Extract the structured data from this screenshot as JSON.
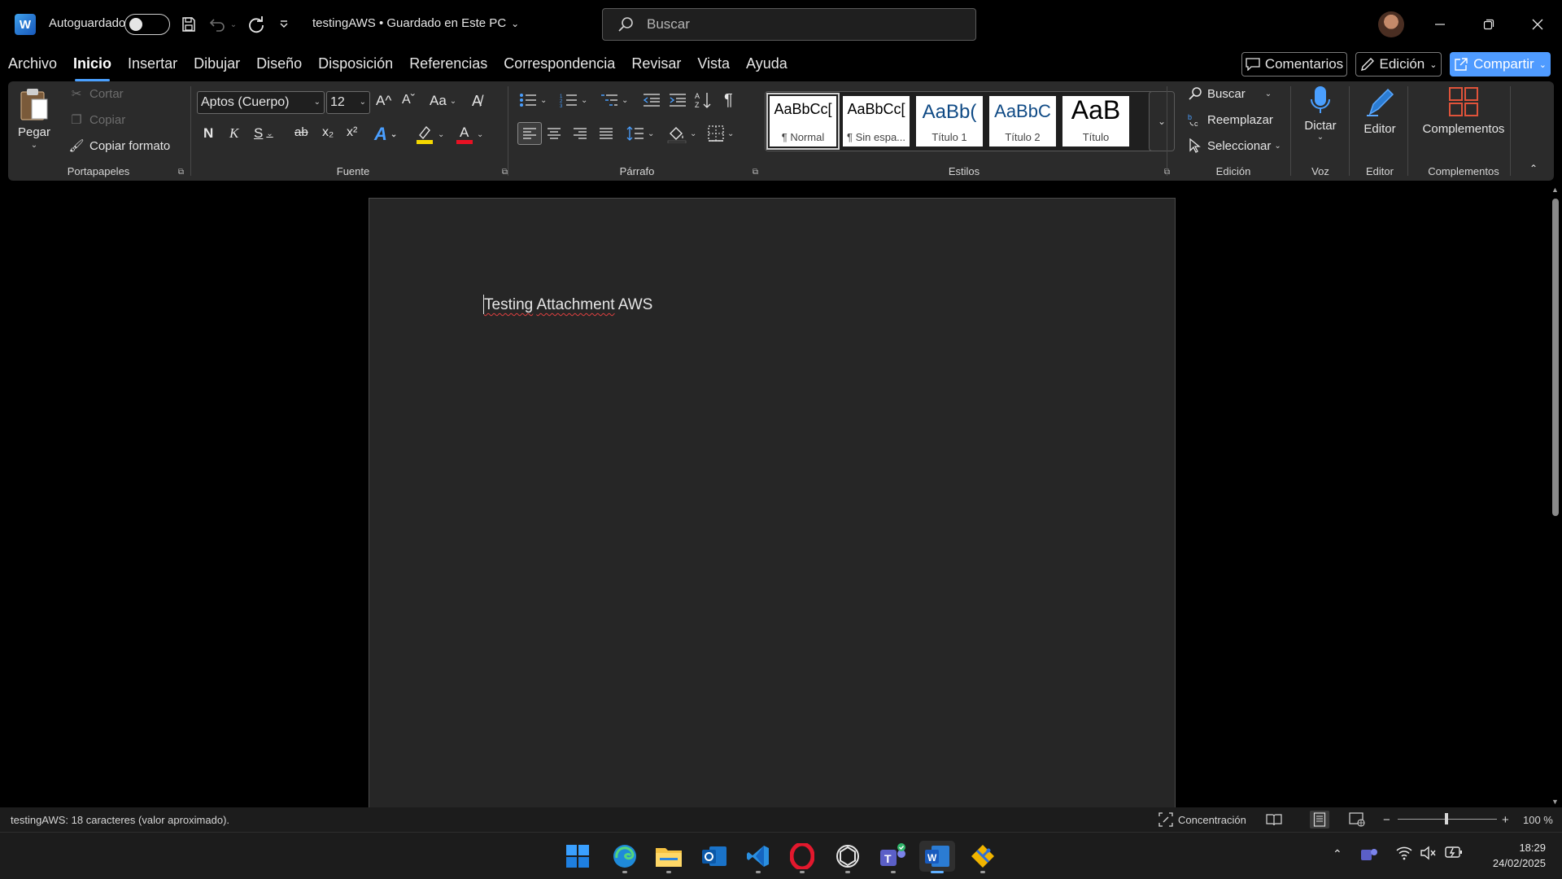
{
  "titlebar": {
    "autosave_label": "Autoguardado",
    "doc_title": "testingAWS • Guardado en Este PC",
    "search_placeholder": "Buscar"
  },
  "tabs": [
    "Archivo",
    "Inicio",
    "Insertar",
    "Dibujar",
    "Diseño",
    "Disposición",
    "Referencias",
    "Correspondencia",
    "Revisar",
    "Vista",
    "Ayuda"
  ],
  "active_tab": "Inicio",
  "right_buttons": {
    "comments": "Comentarios",
    "editing": "Edición",
    "share": "Compartir"
  },
  "ribbon": {
    "clipboard": {
      "paste": "Pegar",
      "cut": "Cortar",
      "copy": "Copiar",
      "format_painter": "Copiar formato",
      "label": "Portapapeles"
    },
    "font": {
      "name": "Aptos (Cuerpo)",
      "size": "12",
      "grow_glyph": "A^",
      "shrink_glyph": "Aˇ",
      "case_glyph": "Aa",
      "bold": "N",
      "italic": "K",
      "underline": "S",
      "strike": "ab",
      "subscript": "x₂",
      "superscript": "x²",
      "label": "Fuente",
      "highlight_color": "#f5d800",
      "font_color": "#e81123"
    },
    "paragraph": {
      "pilcrow": "¶",
      "label": "Párrafo"
    },
    "styles": {
      "items": [
        {
          "preview": "AaBbCc[",
          "name": "¶ Normal"
        },
        {
          "preview": "AaBbCc[",
          "name": "¶ Sin espa..."
        },
        {
          "preview": "AaBb(",
          "name": "Título 1"
        },
        {
          "preview": "AaBbC",
          "name": "Título 2"
        },
        {
          "preview": "AaB",
          "name": "Título"
        }
      ],
      "label": "Estilos"
    },
    "editing": {
      "find": "Buscar",
      "replace": "Reemplazar",
      "select": "Seleccionar",
      "label": "Edición"
    },
    "voice": {
      "dictate": "Dictar",
      "label": "Voz"
    },
    "editor": {
      "button": "Editor",
      "label": "Editor"
    },
    "addins": {
      "button": "Complementos",
      "label": "Complementos"
    }
  },
  "document": {
    "text_word1": "Testing",
    "text_word2": "Attachment",
    "text_rest": " AWS"
  },
  "statusbar": {
    "words": "testingAWS: 18 caracteres (valor aproximado).",
    "focus": "Concentración",
    "zoom_minus": "−",
    "zoom_plus": "+",
    "zoom": "100 %",
    "zoom_level": 100
  },
  "taskbar": {
    "apps": [
      "start-icon",
      "edge-icon",
      "file-explorer-icon",
      "outlook-icon",
      "vscode-icon",
      "opera-icon",
      "chatgpt-icon",
      "teams-icon",
      "word-icon",
      "git-icon"
    ],
    "time": "18:29",
    "date": "24/02/2025"
  },
  "colors": {
    "accent": "#4f9bff",
    "word_blue": "#185abd",
    "spell_underline": "#e04040"
  }
}
